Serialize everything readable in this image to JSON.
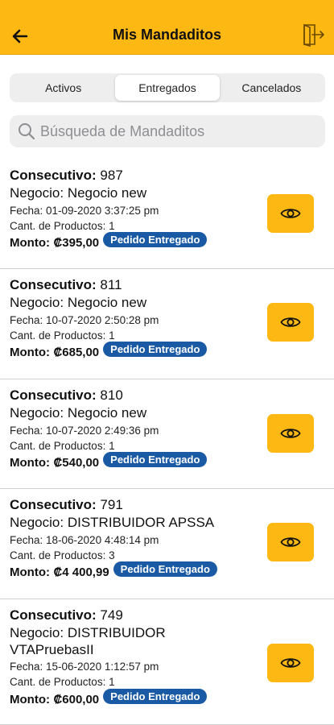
{
  "header": {
    "title": "Mis Mandaditos",
    "accent": "#FDB813"
  },
  "tabs": [
    {
      "label": "Activos",
      "active": false
    },
    {
      "label": "Entregados",
      "active": true
    },
    {
      "label": "Cancelados",
      "active": false
    }
  ],
  "search": {
    "placeholder": "Búsqueda de Mandaditos"
  },
  "labels": {
    "consecutivo": "Consecutivo:",
    "monto": "Monto:"
  },
  "status_color": "#1a5aa5",
  "orders": [
    {
      "consecutivo": "987",
      "negocio": "Negocio: Negocio new",
      "fecha": "Fecha: 01-09-2020 3:37:25 pm",
      "productos": "Cant. de Productos: 1",
      "monto": "₡395,00",
      "status": "Pedido Entregado"
    },
    {
      "consecutivo": "811",
      "negocio": "Negocio: Negocio new",
      "fecha": "Fecha: 10-07-2020 2:50:28 pm",
      "productos": "Cant. de Productos: 1",
      "monto": "₡685,00",
      "status": "Pedido Entregado"
    },
    {
      "consecutivo": "810",
      "negocio": "Negocio: Negocio new",
      "fecha": "Fecha: 10-07-2020 2:49:36 pm",
      "productos": "Cant. de Productos: 1",
      "monto": "₡540,00",
      "status": "Pedido Entregado"
    },
    {
      "consecutivo": "791",
      "negocio": "Negocio: DISTRIBUIDOR APSSA",
      "fecha": "Fecha: 18-06-2020 4:48:14 pm",
      "productos": "Cant. de Productos: 3",
      "monto": "₡4 400,99",
      "status": "Pedido Entregado"
    },
    {
      "consecutivo": "749",
      "negocio": "Negocio: DISTRIBUIDOR VTAPruebasII",
      "fecha": "Fecha: 15-06-2020 1:12:57 pm",
      "productos": "Cant. de Productos: 1",
      "monto": "₡600,00",
      "status": "Pedido Entregado"
    }
  ]
}
